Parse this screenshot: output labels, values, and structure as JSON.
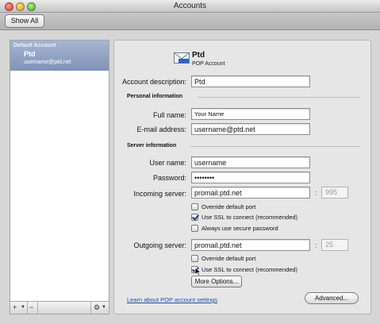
{
  "window": {
    "title": "Accounts"
  },
  "toolbar": {
    "show_all": "Show All"
  },
  "sidebar": {
    "header": "Default Account",
    "account_name": "Ptd",
    "account_email": "username@ptd.net"
  },
  "account": {
    "title": "Ptd",
    "type": "POP Account"
  },
  "form": {
    "account_description": {
      "label": "Account description:",
      "value": "Ptd"
    },
    "personal_section": "Personal information",
    "full_name": {
      "label": "Full name:",
      "value": "Your Name"
    },
    "email": {
      "label": "E-mail address:",
      "value": "username@ptd.net"
    },
    "server_section": "Server information",
    "user_name": {
      "label": "User name:",
      "value": "username"
    },
    "password": {
      "label": "Password:",
      "value": "••••••••"
    },
    "incoming": {
      "label": "Incoming server:",
      "value": "promail.ptd.net",
      "port": "995"
    },
    "incoming_override": "Override default port",
    "incoming_ssl": "Use SSL to connect (recommended)",
    "incoming_secure_pw": "Always use secure password",
    "outgoing": {
      "label": "Outgoing server:",
      "value": "promail.ptd.net",
      "port": "25"
    },
    "outgoing_override": "Override default port",
    "outgoing_ssl": "Use SSL to connect (recommended)",
    "more_options": "More Options...",
    "learn_link": "Learn about POP account settings",
    "advanced": "Advanced...",
    "colon": ":"
  },
  "checkboxes": {
    "incoming_override": false,
    "incoming_ssl": true,
    "incoming_secure_pw": false,
    "outgoing_override": false,
    "outgoing_ssl": true
  },
  "colors": {
    "selection": "#8a9cc0",
    "link": "#1d4fa8"
  }
}
